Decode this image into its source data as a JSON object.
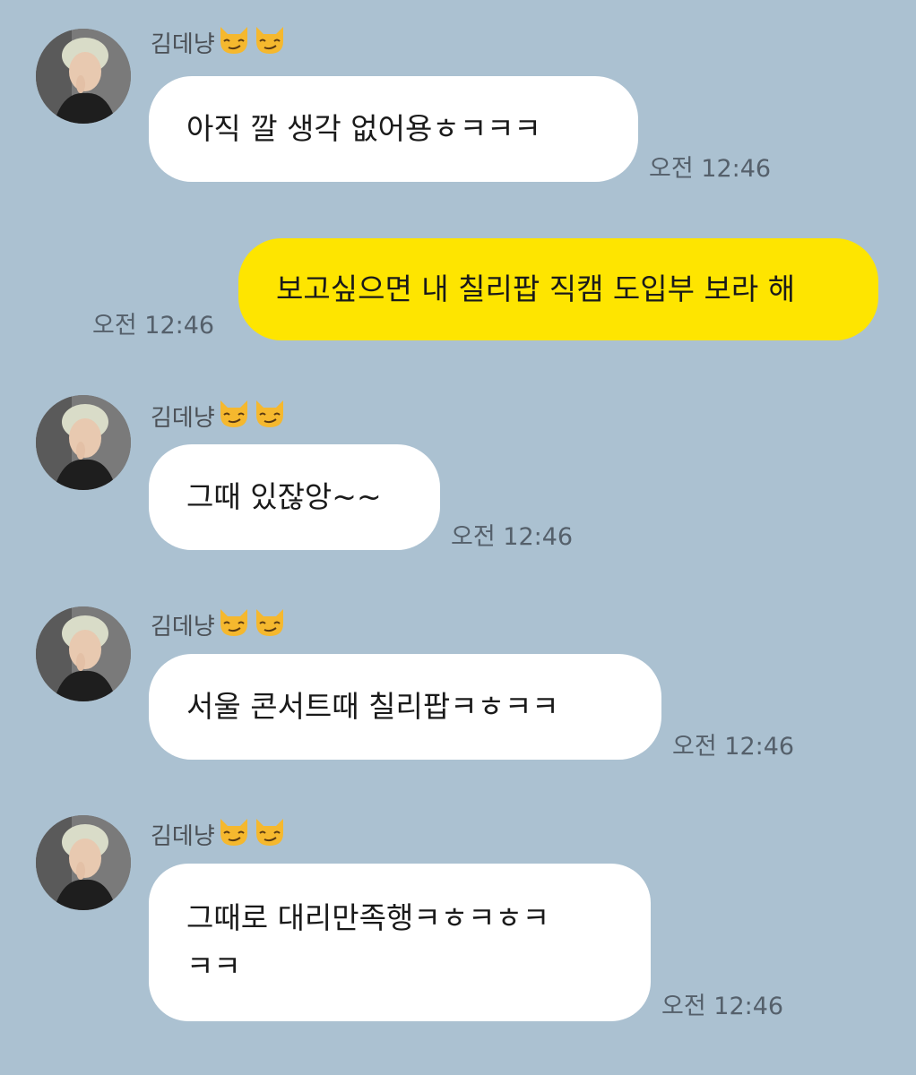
{
  "chat": {
    "messages": [
      {
        "sender": "김데냥",
        "emoji": [
          "smirking-cat-emoji",
          "smirking-cat-emoji"
        ],
        "text": "아직 깔 생각 없어용ㅎㅋㅋㅋ",
        "time": "오전 12:46"
      },
      {
        "sender": "me",
        "text": "보고싶으면 내 칠리팝 직캠 도입부 보라 해",
        "time": "오전 12:46"
      },
      {
        "sender": "김데냥",
        "emoji": [
          "smirking-cat-emoji",
          "smirking-cat-emoji"
        ],
        "text": "그때 있잖앙~~",
        "time": "오전 12:46"
      },
      {
        "sender": "김데냥",
        "emoji": [
          "smirking-cat-emoji",
          "smirking-cat-emoji"
        ],
        "text": "서울 콘서트때 칠리팝ㅋㅎㅋㅋ",
        "time": "오전 12:46"
      },
      {
        "sender": "김데냥",
        "emoji": [
          "smirking-cat-emoji",
          "smirking-cat-emoji"
        ],
        "text_lines": [
          "그때로 대리만족행ㅋㅎㅋㅎㅋ",
          "ㅋㅋ"
        ],
        "time": "오전 12:46"
      }
    ]
  },
  "colors": {
    "background": "#abc1d1",
    "incoming_bubble": "#ffffff",
    "outgoing_bubble": "#fee500",
    "timestamp": "#55606b",
    "sender_name": "#4a4f55"
  }
}
